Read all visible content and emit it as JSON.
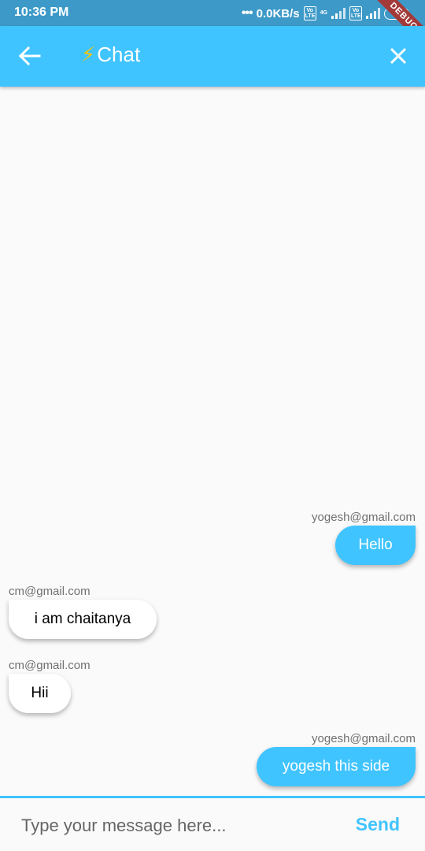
{
  "status_bar": {
    "time": "10:36 PM",
    "net_speed": "0.0KB/s",
    "volte1": "Vo LTE",
    "network_type": "4G",
    "volte2": "Vo LTE",
    "battery": "78",
    "debug_banner": "DEBUG"
  },
  "app_bar": {
    "title_icon": "⚡",
    "title": "Chat",
    "back_icon": "arrow-left-icon",
    "close_icon": "close-icon"
  },
  "colors": {
    "accent": "#40c4ff",
    "status_bar": "#3d9ac8",
    "background": "#fafafa"
  },
  "messages": [
    {
      "sender": "yogesh@gmail.com",
      "text": "Hello",
      "direction": "outgoing"
    },
    {
      "sender": "cm@gmail.com",
      "text": "i am chaitanya",
      "direction": "incoming"
    },
    {
      "sender": "cm@gmail.com",
      "text": "Hii",
      "direction": "incoming"
    },
    {
      "sender": "yogesh@gmail.com",
      "text": "yogesh this side",
      "direction": "outgoing"
    }
  ],
  "composer": {
    "placeholder": "Type your message here...",
    "value": "",
    "send_label": "Send"
  }
}
